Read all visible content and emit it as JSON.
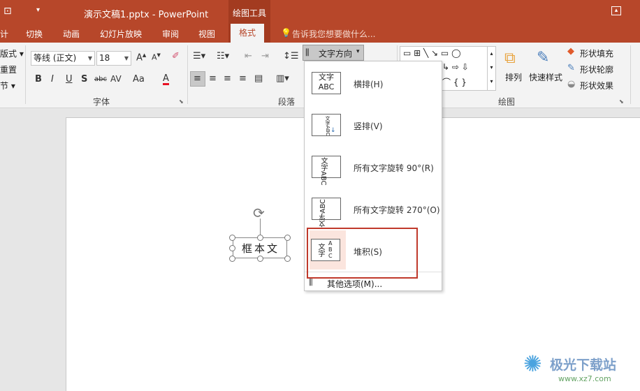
{
  "titlebar": {
    "qa_icon": "view-icon",
    "qa_dropdown": "▾",
    "title": "演示文稿1.pptx - PowerPoint",
    "context_group": "绘图工具",
    "restore_icon": "restore-icon"
  },
  "tabs": {
    "partial_left": "计",
    "items": [
      "切换",
      "动画",
      "幻灯片放映",
      "审阅",
      "视图"
    ],
    "active": "格式",
    "tell_me": "告诉我您想要做什么..."
  },
  "ribbon": {
    "left_partial": [
      "版式 ▾",
      "重置",
      "节 ▾"
    ],
    "font_name": "等线 (正文)",
    "font_size": "18",
    "font_group_label": "字体",
    "paragraph_group_label": "段落",
    "text_direction_label": "文字方向",
    "drawing_group_label": "绘图",
    "arrange_label": "排列",
    "quick_styles_label": "快速样式",
    "shape_fill": "形状填充",
    "shape_outline": "形状轮廓",
    "shape_effects": "形状效果",
    "format_buttons": [
      "B",
      "I",
      "U",
      "S",
      "abc",
      "AV",
      "Aa",
      "A"
    ]
  },
  "dropdown": {
    "items": [
      {
        "label": "横排(H)",
        "icon_top": "文字",
        "icon_bottom": "ABC"
      },
      {
        "label": "竖排(V)",
        "icon_top": "",
        "icon_bottom": ""
      },
      {
        "label": "所有文字旋转 90°(R)",
        "icon_top": "",
        "icon_bottom": ""
      },
      {
        "label": "所有文字旋转 270°(O)",
        "icon_top": "",
        "icon_bottom": ""
      },
      {
        "label": "堆积(S)",
        "icon_top": "",
        "icon_bottom": ""
      }
    ],
    "more_options": "其他选项(M)..."
  },
  "slide": {
    "textbox_text": "框本文"
  },
  "watermark": {
    "brand": "极光下载站",
    "url": "www.xz7.com"
  },
  "colors": {
    "brand": "#b7472a",
    "highlight": "#c0392b"
  }
}
